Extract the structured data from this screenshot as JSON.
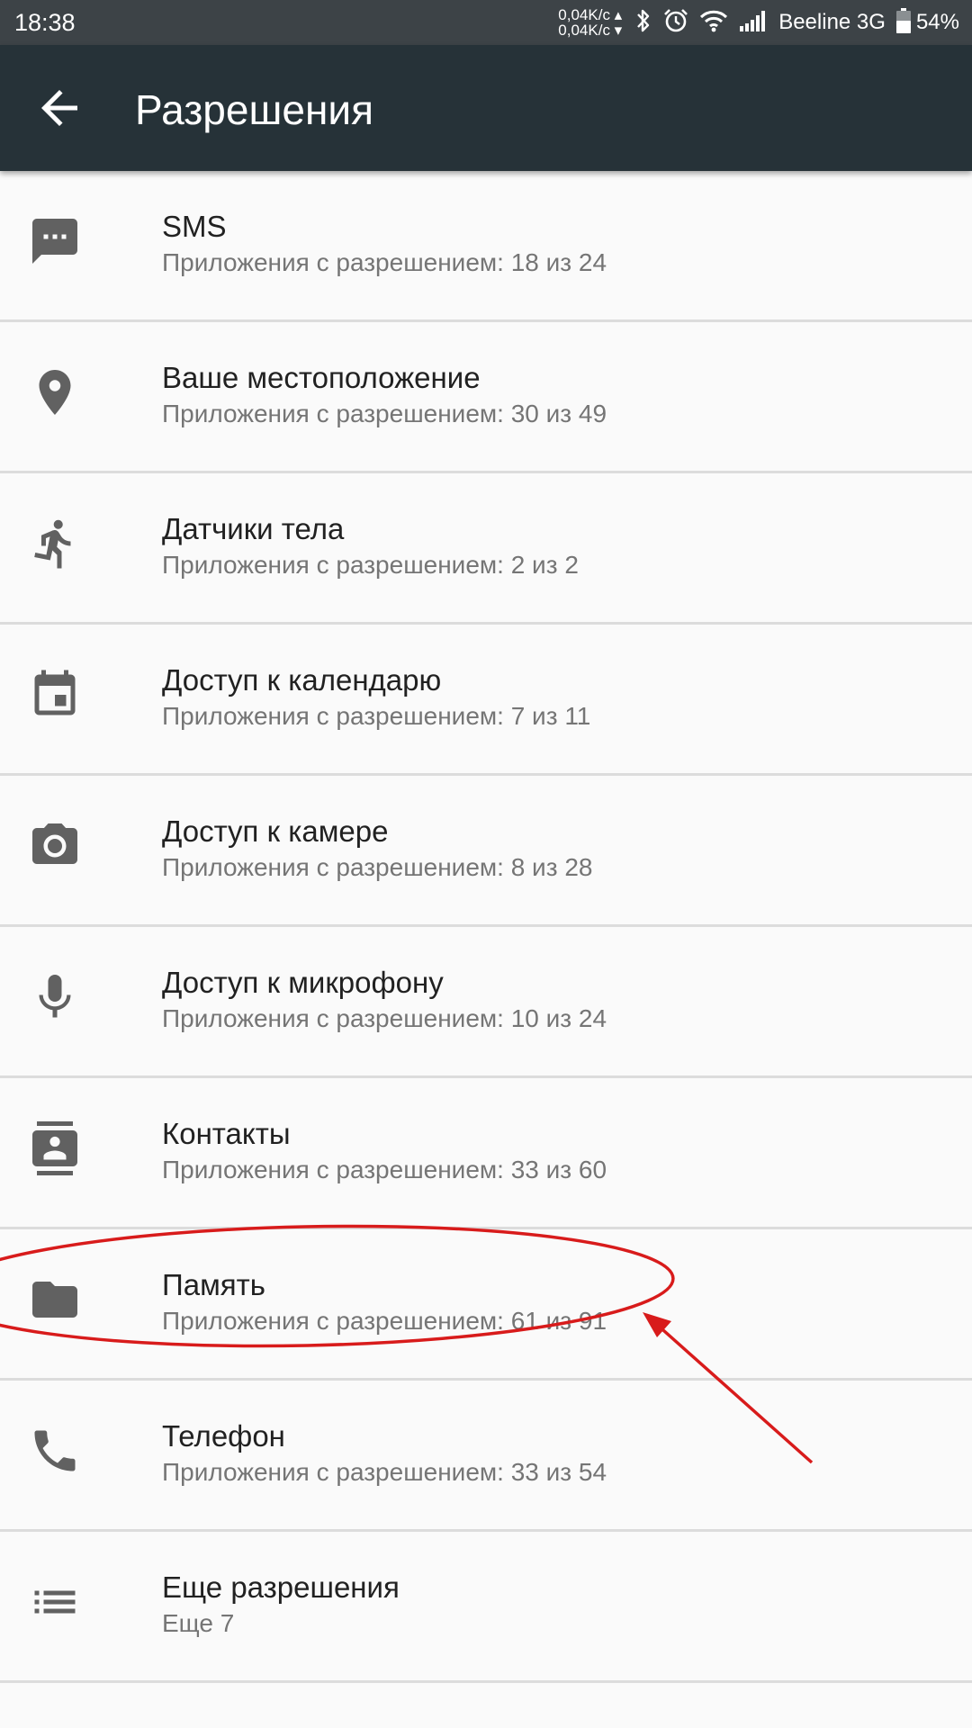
{
  "status_bar": {
    "time": "18:38",
    "net_up": "0,04K/c ▴",
    "net_down": "0,04K/c ▾",
    "carrier": "Beeline 3G",
    "battery": "54%",
    "icons": [
      "bluetooth-icon",
      "alarm-icon",
      "wifi-icon",
      "signal-icon",
      "battery-icon"
    ]
  },
  "app_bar": {
    "title": "Разрешения",
    "back_icon": "arrow-back-icon"
  },
  "permissions": [
    {
      "icon": "sms-icon",
      "title": "SMS",
      "subtitle": "Приложения с разрешением: 18 из 24"
    },
    {
      "icon": "location-icon",
      "title": "Ваше местоположение",
      "subtitle": "Приложения с разрешением: 30 из 49"
    },
    {
      "icon": "body-sensors-icon",
      "title": "Датчики тела",
      "subtitle": "Приложения с разрешением: 2 из 2"
    },
    {
      "icon": "calendar-icon",
      "title": "Доступ к календарю",
      "subtitle": "Приложения с разрешением: 7 из 11"
    },
    {
      "icon": "camera-icon",
      "title": "Доступ к камере",
      "subtitle": "Приложения с разрешением: 8 из 28"
    },
    {
      "icon": "microphone-icon",
      "title": "Доступ к микрофону",
      "subtitle": "Приложения с разрешением: 10 из 24"
    },
    {
      "icon": "contacts-icon",
      "title": "Контакты",
      "subtitle": "Приложения с разрешением: 33 из 60"
    },
    {
      "icon": "folder-icon",
      "title": "Память",
      "subtitle": "Приложения с разрешением: 61 из 91"
    },
    {
      "icon": "phone-icon",
      "title": "Телефон",
      "subtitle": "Приложения с разрешением: 33 из 54"
    },
    {
      "icon": "list-icon",
      "title": "Еще разрешения",
      "subtitle": "Еще 7"
    }
  ],
  "colors": {
    "status_bar": "#3d4347",
    "app_bar": "#263238",
    "background": "#fafafa",
    "icon": "#616161",
    "annotation": "#d81b1b"
  }
}
